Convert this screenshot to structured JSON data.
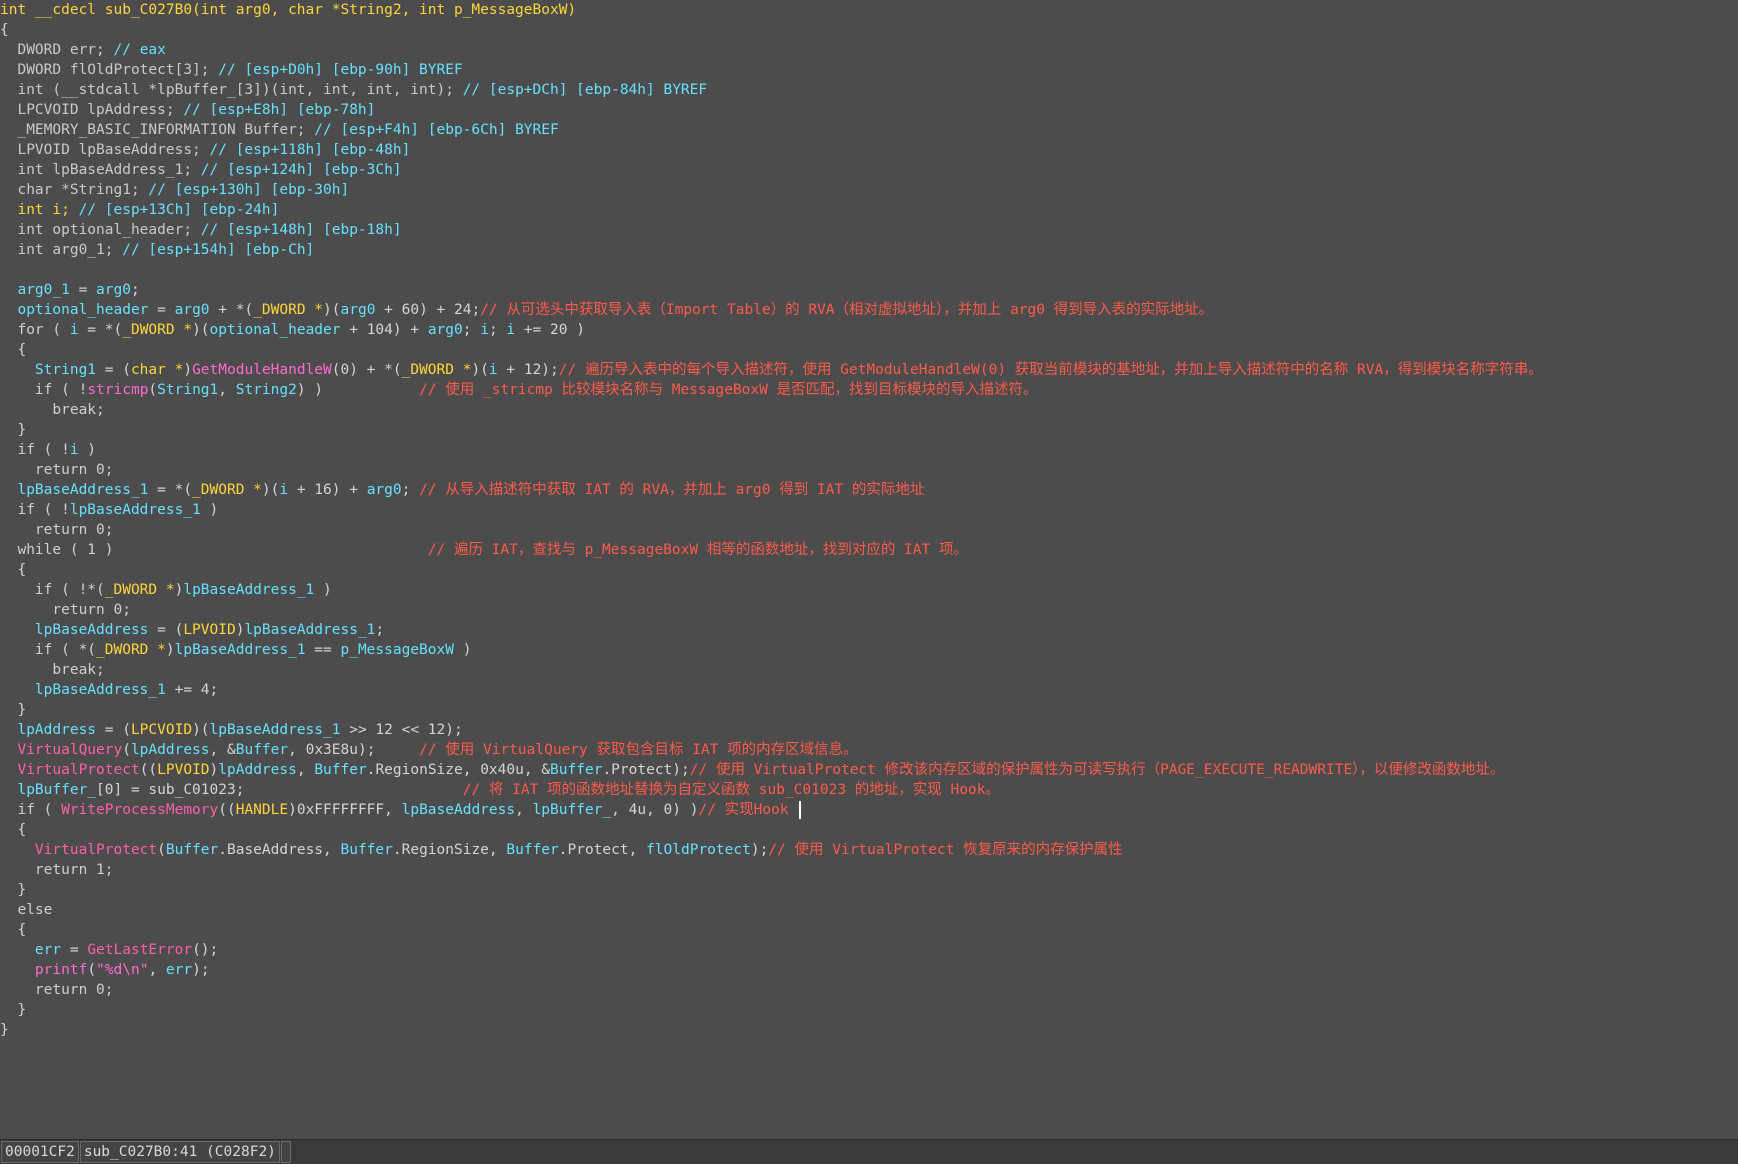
{
  "code_lines": [
    [
      [
        "int __cdecl sub_C027B0(int arg0, char *String2, int p_MessageBoxW)",
        "t-var"
      ]
    ],
    [
      [
        "{",
        "t-plain"
      ]
    ],
    [
      [
        "  DWORD ",
        "t-type"
      ],
      [
        "err",
        "t-type"
      ],
      [
        "; ",
        "t-plain"
      ],
      [
        "// eax",
        "t-glob"
      ]
    ],
    [
      [
        "  DWORD flOldProtect[3]; ",
        "t-type"
      ],
      [
        "// [esp+D0h] [ebp-90h] BYREF",
        "t-glob"
      ]
    ],
    [
      [
        "  int (__stdcall *lpBuffer_[3])(int, int, int, int); ",
        "t-type"
      ],
      [
        "// [esp+DCh] [ebp-84h] BYREF",
        "t-glob"
      ]
    ],
    [
      [
        "  LPCVOID lpAddress; ",
        "t-type"
      ],
      [
        "// [esp+E8h] [ebp-78h]",
        "t-glob"
      ]
    ],
    [
      [
        "  _MEMORY_BASIC_INFORMATION Buffer; ",
        "t-type"
      ],
      [
        "// [esp+F4h] [ebp-6Ch] BYREF",
        "t-glob"
      ]
    ],
    [
      [
        "  LPVOID lpBaseAddress; ",
        "t-type"
      ],
      [
        "// [esp+118h] [ebp-48h]",
        "t-glob"
      ]
    ],
    [
      [
        "  int lpBaseAddress_1; ",
        "t-type"
      ],
      [
        "// [esp+124h] [ebp-3Ch]",
        "t-glob"
      ]
    ],
    [
      [
        "  char *String1; ",
        "t-type"
      ],
      [
        "// [esp+130h] [ebp-30h]",
        "t-glob"
      ]
    ],
    [
      [
        "  int i; ",
        "t-var"
      ],
      [
        "// [esp+13Ch] [ebp-24h]",
        "t-glob"
      ]
    ],
    [
      [
        "  int optional_header; ",
        "t-type"
      ],
      [
        "// [esp+148h] [ebp-18h]",
        "t-glob"
      ]
    ],
    [
      [
        "  int arg0_1; ",
        "t-type"
      ],
      [
        "// [esp+154h] [ebp-Ch]",
        "t-glob"
      ]
    ],
    [
      [
        "",
        "t-plain"
      ]
    ],
    [
      [
        "  arg0_1",
        "t-glob"
      ],
      [
        " = ",
        "t-plain"
      ],
      [
        "arg0",
        "t-glob"
      ],
      [
        ";",
        "t-plain"
      ]
    ],
    [
      [
        "  optional_header",
        "t-glob"
      ],
      [
        " = ",
        "t-plain"
      ],
      [
        "arg0",
        "t-glob"
      ],
      [
        " + *(",
        "t-plain"
      ],
      [
        "_DWORD *",
        "t-var"
      ],
      [
        ")(",
        "t-plain"
      ],
      [
        "arg0",
        "t-glob"
      ],
      [
        " + 60) + 24;",
        "t-plain"
      ],
      [
        "// 从可选头中获取导入表（Import Table）的 RVA（相对虚拟地址），并加上 arg0 得到导入表的实际地址。",
        "t-cmt"
      ]
    ],
    [
      [
        "  for ( ",
        "t-kw"
      ],
      [
        "i",
        "t-glob"
      ],
      [
        " = *(",
        "t-plain"
      ],
      [
        "_DWORD *",
        "t-var"
      ],
      [
        ")(",
        "t-plain"
      ],
      [
        "optional_header",
        "t-glob"
      ],
      [
        " + 104) + ",
        "t-plain"
      ],
      [
        "arg0",
        "t-glob"
      ],
      [
        "; ",
        "t-plain"
      ],
      [
        "i",
        "t-glob"
      ],
      [
        "; ",
        "t-plain"
      ],
      [
        "i",
        "t-glob"
      ],
      [
        " += 20 )",
        "t-plain"
      ]
    ],
    [
      [
        "  {",
        "t-plain"
      ]
    ],
    [
      [
        "    String1",
        "t-glob"
      ],
      [
        " = (",
        "t-plain"
      ],
      [
        "char *",
        "t-var"
      ],
      [
        ")",
        "t-plain"
      ],
      [
        "GetModuleHandleW",
        "t-fn"
      ],
      [
        "(0) + *(",
        "t-plain"
      ],
      [
        "_DWORD *",
        "t-var"
      ],
      [
        ")(",
        "t-plain"
      ],
      [
        "i",
        "t-glob"
      ],
      [
        " + 12);",
        "t-plain"
      ],
      [
        "// 遍历导入表中的每个导入描述符，使用 GetModuleHandleW(0) 获取当前模块的基地址，并加上导入描述符中的名称 RVA，得到模块名称字符串。",
        "t-cmt"
      ]
    ],
    [
      [
        "    if ( !",
        "t-kw"
      ],
      [
        "stricmp",
        "t-fn"
      ],
      [
        "(",
        "t-plain"
      ],
      [
        "String1",
        "t-glob"
      ],
      [
        ", ",
        "t-plain"
      ],
      [
        "String2",
        "t-glob"
      ],
      [
        ") )           ",
        "t-plain"
      ],
      [
        "// 使用 _stricmp 比较模块名称与 MessageBoxW 是否匹配，找到目标模块的导入描述符。",
        "t-cmt"
      ]
    ],
    [
      [
        "      break;",
        "t-kw"
      ]
    ],
    [
      [
        "  }",
        "t-plain"
      ]
    ],
    [
      [
        "  if ( !",
        "t-kw"
      ],
      [
        "i",
        "t-glob"
      ],
      [
        " )",
        "t-plain"
      ]
    ],
    [
      [
        "    return 0;",
        "t-kw"
      ]
    ],
    [
      [
        "  lpBaseAddress_1",
        "t-glob"
      ],
      [
        " = *(",
        "t-plain"
      ],
      [
        "_DWORD *",
        "t-var"
      ],
      [
        ")(",
        "t-plain"
      ],
      [
        "i",
        "t-glob"
      ],
      [
        " + 16) + ",
        "t-plain"
      ],
      [
        "arg0",
        "t-glob"
      ],
      [
        "; ",
        "t-plain"
      ],
      [
        "// 从导入描述符中获取 IAT 的 RVA，并加上 arg0 得到 IAT 的实际地址",
        "t-cmt"
      ]
    ],
    [
      [
        "  if ( !",
        "t-kw"
      ],
      [
        "lpBaseAddress_1",
        "t-glob"
      ],
      [
        " )",
        "t-plain"
      ]
    ],
    [
      [
        "    return 0;",
        "t-kw"
      ]
    ],
    [
      [
        "  while ( 1 )                                    ",
        "t-kw"
      ],
      [
        "// 遍历 IAT，查找与 p_MessageBoxW 相等的函数地址，找到对应的 IAT 项。",
        "t-cmt"
      ]
    ],
    [
      [
        "  {",
        "t-plain"
      ]
    ],
    [
      [
        "    if ( !*(",
        "t-kw"
      ],
      [
        "_DWORD *",
        "t-var"
      ],
      [
        ")",
        "t-plain"
      ],
      [
        "lpBaseAddress_1",
        "t-glob"
      ],
      [
        " )",
        "t-plain"
      ]
    ],
    [
      [
        "      return 0;",
        "t-kw"
      ]
    ],
    [
      [
        "    lpBaseAddress",
        "t-glob"
      ],
      [
        " = (",
        "t-plain"
      ],
      [
        "LPVOID",
        "t-var"
      ],
      [
        ")",
        "t-plain"
      ],
      [
        "lpBaseAddress_1",
        "t-glob"
      ],
      [
        ";",
        "t-plain"
      ]
    ],
    [
      [
        "    if ( *(",
        "t-kw"
      ],
      [
        "_DWORD *",
        "t-var"
      ],
      [
        ")",
        "t-plain"
      ],
      [
        "lpBaseAddress_1",
        "t-glob"
      ],
      [
        " == ",
        "t-plain"
      ],
      [
        "p_MessageBoxW",
        "t-glob"
      ],
      [
        " )",
        "t-plain"
      ]
    ],
    [
      [
        "      break;",
        "t-kw"
      ]
    ],
    [
      [
        "    lpBaseAddress_1",
        "t-glob"
      ],
      [
        " += 4;",
        "t-plain"
      ]
    ],
    [
      [
        "  }",
        "t-plain"
      ]
    ],
    [
      [
        "  lpAddress",
        "t-glob"
      ],
      [
        " = (",
        "t-plain"
      ],
      [
        "LPCVOID",
        "t-var"
      ],
      [
        ")(",
        "t-plain"
      ],
      [
        "lpBaseAddress_1",
        "t-glob"
      ],
      [
        " >> 12 << 12);",
        "t-plain"
      ]
    ],
    [
      [
        "  VirtualQuery",
        "t-lib"
      ],
      [
        "(",
        "t-plain"
      ],
      [
        "lpAddress",
        "t-glob"
      ],
      [
        ", &",
        "t-plain"
      ],
      [
        "Buffer",
        "t-glob"
      ],
      [
        ", 0x3E8u);     ",
        "t-plain"
      ],
      [
        "// 使用 VirtualQuery 获取包含目标 IAT 项的内存区域信息。",
        "t-cmt"
      ]
    ],
    [
      [
        "  VirtualProtect",
        "t-lib"
      ],
      [
        "((",
        "t-plain"
      ],
      [
        "LPVOID",
        "t-var"
      ],
      [
        ")",
        "t-plain"
      ],
      [
        "lpAddress",
        "t-glob"
      ],
      [
        ", ",
        "t-plain"
      ],
      [
        "Buffer",
        "t-glob"
      ],
      [
        ".RegionSize, 0x40u, &",
        "t-plain"
      ],
      [
        "Buffer",
        "t-glob"
      ],
      [
        ".Protect);",
        "t-plain"
      ],
      [
        "// 使用 VirtualProtect 修改该内存区域的保护属性为可读写执行（PAGE_EXECUTE_READWRITE），以便修改函数地址。",
        "t-cmt"
      ]
    ],
    [
      [
        "  lpBuffer_",
        "t-glob"
      ],
      [
        "[0] = sub_C01023;                         ",
        "t-plain"
      ],
      [
        "// 将 IAT 项的函数地址替换为自定义函数 sub_C01023 的地址，实现 Hook。",
        "t-cmt"
      ]
    ],
    [
      [
        "  if ( ",
        "t-kw"
      ],
      [
        "WriteProcessMemory",
        "t-lib"
      ],
      [
        "((",
        "t-plain"
      ],
      [
        "HANDLE",
        "t-var"
      ],
      [
        ")0xFFFFFFFF, ",
        "t-plain"
      ],
      [
        "lpBaseAddress",
        "t-glob"
      ],
      [
        ", ",
        "t-plain"
      ],
      [
        "lpBuffer_",
        "t-glob"
      ],
      [
        ", 4u, 0) )",
        "t-plain"
      ],
      [
        "// 实现Hook ",
        "t-cmt"
      ],
      [
        "__CARET__",
        "caret"
      ]
    ],
    [
      [
        "  {",
        "t-plain"
      ]
    ],
    [
      [
        "    VirtualProtect",
        "t-lib"
      ],
      [
        "(",
        "t-plain"
      ],
      [
        "Buffer",
        "t-glob"
      ],
      [
        ".BaseAddress, ",
        "t-plain"
      ],
      [
        "Buffer",
        "t-glob"
      ],
      [
        ".RegionSize, ",
        "t-plain"
      ],
      [
        "Buffer",
        "t-glob"
      ],
      [
        ".Protect, ",
        "t-plain"
      ],
      [
        "flOldProtect",
        "t-glob"
      ],
      [
        ");",
        "t-plain"
      ],
      [
        "// 使用 VirtualProtect 恢复原来的内存保护属性",
        "t-cmt"
      ]
    ],
    [
      [
        "    return 1;",
        "t-kw"
      ]
    ],
    [
      [
        "  }",
        "t-plain"
      ]
    ],
    [
      [
        "  else",
        "t-kw"
      ]
    ],
    [
      [
        "  {",
        "t-plain"
      ]
    ],
    [
      [
        "    err",
        "t-glob"
      ],
      [
        " = ",
        "t-plain"
      ],
      [
        "GetLastError",
        "t-lib"
      ],
      [
        "();",
        "t-plain"
      ]
    ],
    [
      [
        "    printf",
        "t-fn"
      ],
      [
        "(",
        "t-plain"
      ],
      [
        "\"%d\\n\"",
        "t-strlit"
      ],
      [
        ", ",
        "t-plain"
      ],
      [
        "err",
        "t-glob"
      ],
      [
        ");",
        "t-plain"
      ]
    ],
    [
      [
        "    return 0;",
        "t-kw"
      ]
    ],
    [
      [
        "  }",
        "t-plain"
      ]
    ],
    [
      [
        "}",
        "t-plain"
      ]
    ]
  ],
  "statusbar": {
    "offset": "00001CF2",
    "location": "sub_C027B0:41 (C028F2)"
  }
}
